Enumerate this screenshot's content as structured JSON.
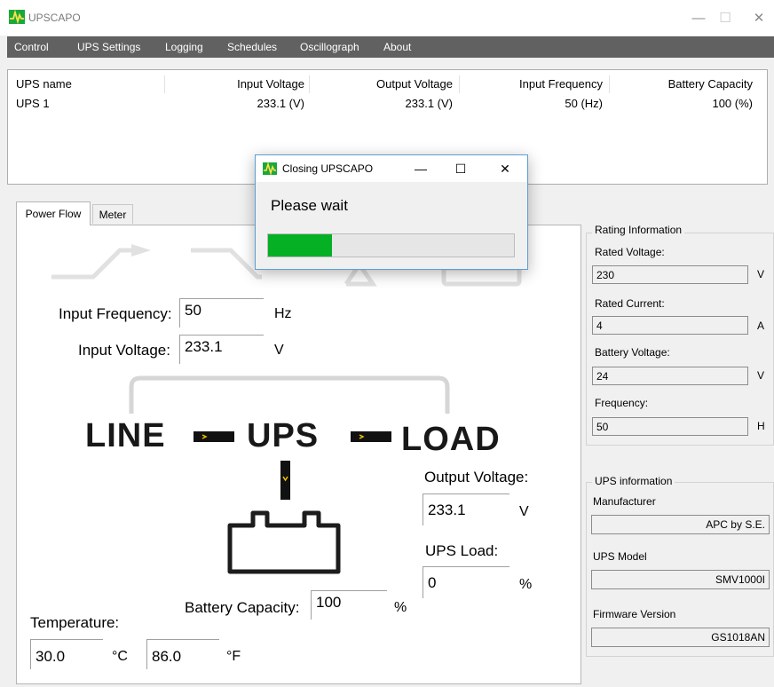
{
  "app": {
    "title": "UPSCAPO"
  },
  "window_controls": {
    "minimize": "—",
    "maximize": "☐",
    "close": "✕"
  },
  "menu": [
    "Control",
    "UPS Settings",
    "Logging",
    "Schedules",
    "Oscillograph",
    "About"
  ],
  "ups_table": {
    "columns": [
      "UPS name",
      "Input Voltage",
      "Output Voltage",
      "Input Frequency",
      "Battery Capacity"
    ],
    "rows": [
      [
        "UPS 1",
        "233.1 (V)",
        "233.1 (V)",
        "50 (Hz)",
        "100 (%)"
      ]
    ]
  },
  "tabs": [
    "Power Flow",
    "Meter"
  ],
  "power_flow": {
    "input_frequency_label": "Input Frequency:",
    "input_frequency_value": "50",
    "input_frequency_unit": "Hz",
    "input_voltage_label": "Input Voltage:",
    "input_voltage_value": "233.1",
    "input_voltage_unit": "V",
    "line_text": "LINE",
    "ups_text": "UPS",
    "load_text": "LOAD",
    "output_voltage_label": "Output Voltage:",
    "output_voltage_value": "233.1",
    "output_voltage_unit": "V",
    "ups_load_label": "UPS Load:",
    "ups_load_value": "0",
    "ups_load_unit": "%",
    "battery_capacity_label": "Battery Capacity:",
    "battery_capacity_value": "100",
    "battery_capacity_unit": "%",
    "temperature_label": "Temperature:",
    "temperature_c": "30.0",
    "temperature_c_unit": "°C",
    "temperature_f": "86.0",
    "temperature_f_unit": "°F"
  },
  "rating_info": {
    "title": "Rating Information",
    "rated_voltage_label": "Rated Voltage:",
    "rated_voltage_value": "230",
    "rated_voltage_unit": "V",
    "rated_current_label": "Rated Current:",
    "rated_current_value": "4",
    "rated_current_unit": "A",
    "battery_voltage_label": "Battery Voltage:",
    "battery_voltage_value": "24",
    "battery_voltage_unit": "V",
    "frequency_label": "Frequency:",
    "frequency_value": "50",
    "frequency_unit": "H"
  },
  "ups_info": {
    "title": "UPS information",
    "manufacturer_label": "Manufacturer",
    "manufacturer_value": "APC by S.E.",
    "model_label": "UPS Model",
    "model_value": "SMV1000I",
    "firmware_label": "Firmware Version",
    "firmware_value": "GS1018AN"
  },
  "dialog": {
    "title": "Closing UPSCAPO",
    "message": "Please wait",
    "progress": 0.26,
    "controls": {
      "minimize": "—",
      "maximize": "☐",
      "close": "✕"
    }
  },
  "colors": {
    "menu_bg": "#616161",
    "progress_fill": "#06b025",
    "logo_green": "#1aa83a",
    "arrow_yellow": "#f2c200",
    "dialog_border": "#5c9fd5"
  },
  "icons": [
    "upscapo-logo-icon",
    "battery-icon",
    "flow-arrow-icon"
  ]
}
